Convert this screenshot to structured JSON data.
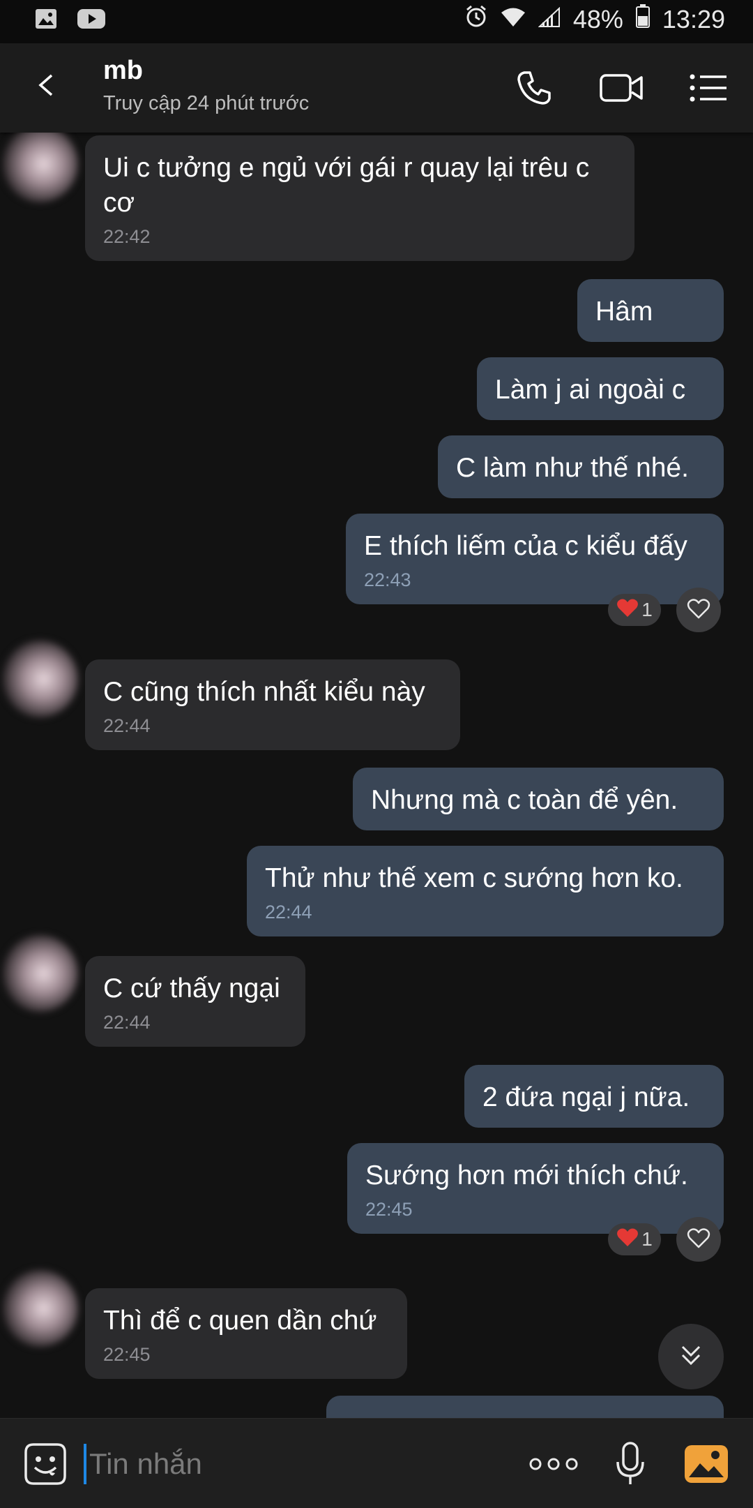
{
  "status_bar": {
    "battery_percent": "48%",
    "time": "13:29",
    "icons": [
      "gallery-icon",
      "youtube-icon",
      "alarm-icon",
      "wifi-icon",
      "signal-icon",
      "battery-icon"
    ]
  },
  "header": {
    "contact_name": "mb",
    "last_seen": "Truy cập 24 phút trước",
    "icons": [
      "back-arrow-icon",
      "phone-icon",
      "video-call-icon",
      "menu-list-icon"
    ]
  },
  "messages": [
    {
      "direction": "in",
      "text": "Ui c tưởng e ngủ với gái r quay lại trêu c cơ",
      "time": "22:42"
    },
    {
      "direction": "out",
      "text": "Hâm"
    },
    {
      "direction": "out",
      "text": "Làm j ai ngoài c"
    },
    {
      "direction": "out",
      "text": "C làm như thế nhé."
    },
    {
      "direction": "out",
      "text": "E thích liếm của c kiểu đấy",
      "time": "22:43",
      "reaction_count": "1"
    },
    {
      "direction": "in",
      "text": "C cũng thích nhất kiểu này",
      "time": "22:44"
    },
    {
      "direction": "out",
      "text": "Nhưng mà c toàn để yên."
    },
    {
      "direction": "out",
      "text": "Thử như thế xem c sướng hơn ko.",
      "time": "22:44"
    },
    {
      "direction": "in",
      "text": "C cứ thấy ngại",
      "time": "22:44"
    },
    {
      "direction": "out",
      "text": "2 đứa ngại j nữa."
    },
    {
      "direction": "out",
      "text": "Sướng hơn mới thích chứ.",
      "time": "22:45",
      "reaction_count": "1"
    },
    {
      "direction": "in",
      "text": "Thì để c quen dần chứ",
      "time": "22:45"
    }
  ],
  "composer": {
    "placeholder": "Tin nhắn",
    "icons": [
      "sticker-icon",
      "more-options-icon",
      "microphone-icon",
      "gallery-photo-icon"
    ]
  },
  "colors": {
    "background": "#121212",
    "incoming_bubble": "#2b2b2d",
    "outgoing_bubble": "#3a4656",
    "accent": "#1e88e5",
    "reaction_heart": "#e53935"
  }
}
